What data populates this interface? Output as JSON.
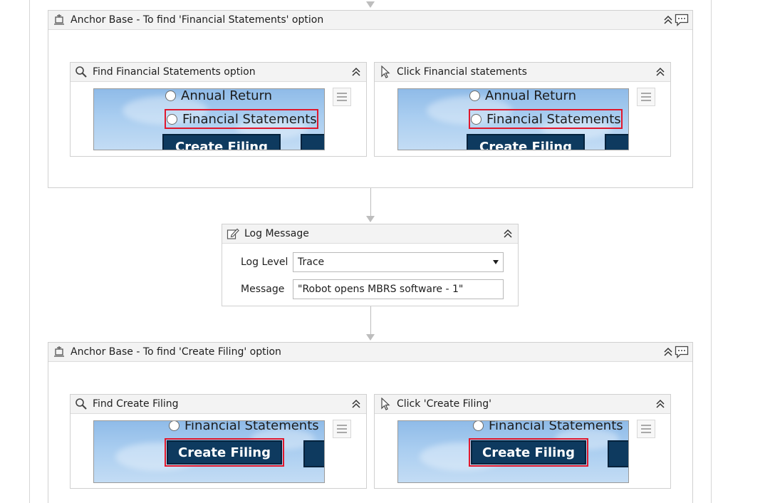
{
  "anchor_base_1": {
    "title": "Anchor Base - To find 'Financial Statements' option",
    "find": {
      "title": "Find Financial Statements option",
      "shot_option_top": "Annual Return",
      "shot_option_selected": "Financial Statements",
      "shot_button": "Create Filing"
    },
    "click": {
      "title": "Click Financial statements",
      "shot_option_top": "Annual Return",
      "shot_option_selected": "Financial Statements",
      "shot_button": "Create Filing"
    }
  },
  "log_message": {
    "title": "Log Message",
    "level_label": "Log Level",
    "level_value": "Trace",
    "message_label": "Message",
    "message_value": "\"Robot opens MBRS software - 1\""
  },
  "anchor_base_2": {
    "title": "Anchor Base - To find 'Create Filing' option",
    "find": {
      "title": "Find Create Filing",
      "shot_option_top": "Financial Statements",
      "shot_button": "Create Filing"
    },
    "click": {
      "title": "Click 'Create Filing'",
      "shot_option_top": "Financial Statements",
      "shot_button": "Create Filing"
    }
  },
  "colors": {
    "highlight": "#e0182d",
    "button_bg": "#0e3a5f",
    "header_bg": "#f3f3f3"
  }
}
